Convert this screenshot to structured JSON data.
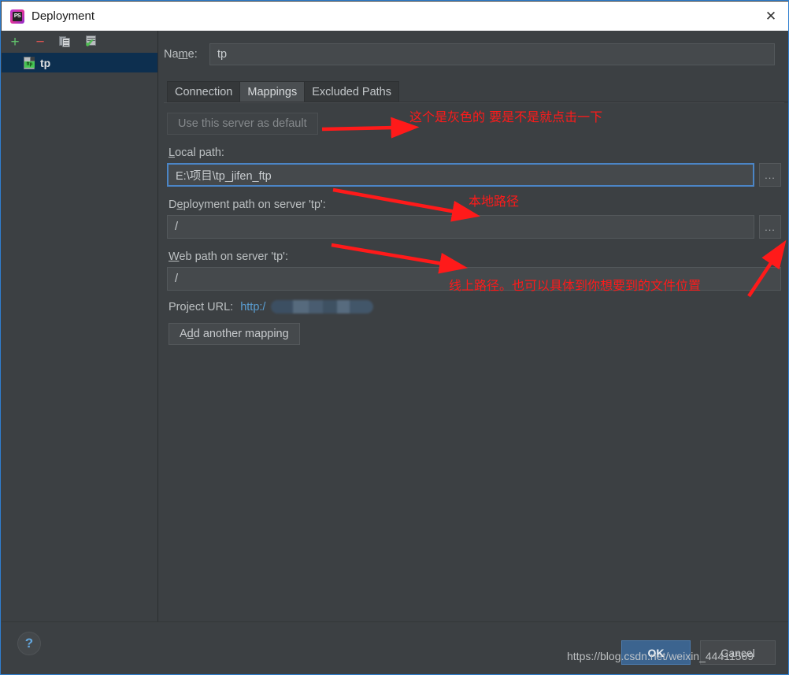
{
  "window": {
    "title": "Deployment",
    "icon": "phpstorm-icon",
    "icon_text": "PS",
    "close_label": "✕"
  },
  "sidebar": {
    "toolbar": [
      {
        "name": "add-server-button",
        "glyph": "+",
        "label": "Add"
      },
      {
        "name": "remove-server-button",
        "glyph": "−",
        "label": "Remove"
      },
      {
        "name": "copy-server-button",
        "glyph": "copy-icon",
        "label": "Copy"
      },
      {
        "name": "use-as-default-button",
        "glyph": "server-check-icon",
        "label": "Use as default"
      }
    ],
    "items": [
      {
        "label": "tp",
        "icon": "ftp-file-icon",
        "badge": "ftp",
        "selected": true
      }
    ]
  },
  "form": {
    "name_label": "Na",
    "name_label_mnemonic": "m",
    "name_label_rest": "e:",
    "name_value": "tp",
    "tabs": [
      {
        "label": "Connection",
        "active": false
      },
      {
        "label": "Mappings",
        "active": true
      },
      {
        "label": "Excluded Paths",
        "active": false
      }
    ],
    "use_default_button": {
      "label": "Use this server as default",
      "disabled": true
    },
    "local_path": {
      "label_mnemonic": "L",
      "label_rest": "ocal path:",
      "value": "E:\\项目\\tp_jifen_ftp",
      "browse_label": "...",
      "focused": true
    },
    "deployment_path": {
      "label_pre": "D",
      "label_mnemonic": "e",
      "label_rest": "ployment path on server 'tp':",
      "value": "/",
      "browse_label": "..."
    },
    "web_path": {
      "label_mnemonic": "W",
      "label_rest": "eb path on server 'tp':",
      "value": "/"
    },
    "project_url": {
      "label": "Project URL:",
      "value": "http:/",
      "redacted": true
    },
    "add_mapping_button": {
      "pre": "A",
      "mnemonic": "d",
      "rest": "d another mapping"
    }
  },
  "footer": {
    "help_label": "?",
    "ok_label": "OK",
    "cancel_label": "Cancel",
    "watermark": "https://blog.csdn.net/weixin_44411569"
  },
  "annotations": [
    {
      "id": "anno-default-gray",
      "text": "这个是灰色的  要是不是就点击一下"
    },
    {
      "id": "anno-local-path",
      "text": "本地路径"
    },
    {
      "id": "anno-remote-path",
      "text": "线上路径。也可以具体到你想要到的文件位置"
    }
  ],
  "colors": {
    "panel_bg": "#3c4043",
    "titlebar_bg": "#ffffff",
    "selection_bg": "#0d2f4f",
    "accent_blue": "#4b85c6",
    "annotation_red": "#ff1a1a",
    "ok_button": "#3c648f"
  }
}
